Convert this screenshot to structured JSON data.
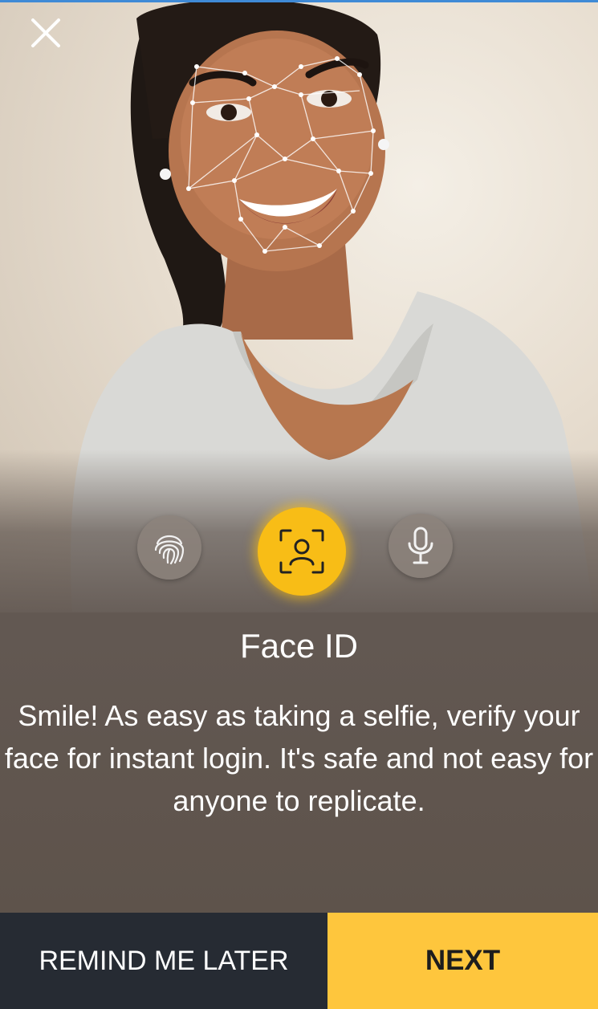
{
  "header": {
    "close_icon": "close-icon"
  },
  "biometrics": {
    "options": [
      {
        "icon": "fingerprint-icon",
        "selected": false
      },
      {
        "icon": "face-scan-icon",
        "selected": true
      },
      {
        "icon": "microphone-icon",
        "selected": false
      }
    ],
    "accent_color": "#f8bd16"
  },
  "content": {
    "title": "Face ID",
    "description": "Smile! As easy as taking a selfie, verify your face for instant login. It's safe and not easy for anyone to replicate."
  },
  "footer": {
    "remind_label": "REMIND ME LATER",
    "next_label": "NEXT",
    "remind_bg": "#262b33",
    "next_bg": "#fec63d"
  }
}
